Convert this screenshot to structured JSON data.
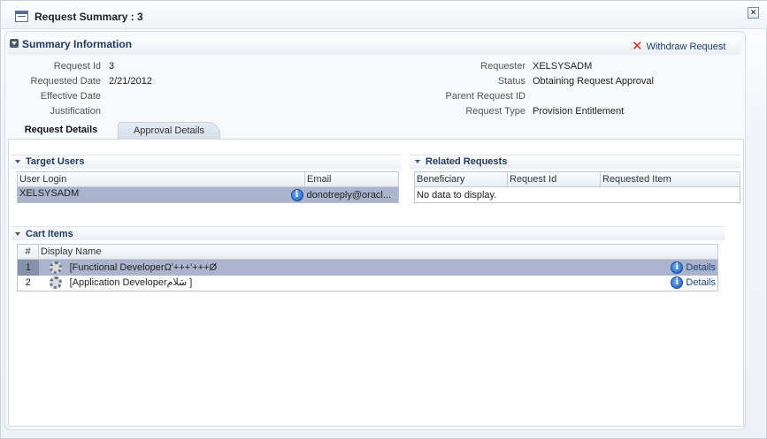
{
  "window": {
    "title": "Request Summary : 3",
    "close_glyph": "×"
  },
  "summary": {
    "title": "Summary Information",
    "withdraw_label": "Withdraw Request",
    "left_fields": [
      {
        "label": "Request Id",
        "value": "3"
      },
      {
        "label": "Requested Date",
        "value": "2/21/2012"
      },
      {
        "label": "Effective Date",
        "value": ""
      },
      {
        "label": "Justification",
        "value": ""
      }
    ],
    "right_fields": [
      {
        "label": "Requester",
        "value": "XELSYSADM"
      },
      {
        "label": "Status",
        "value": "Obtaining Request Approval"
      },
      {
        "label": "Parent Request ID",
        "value": ""
      },
      {
        "label": "Request Type",
        "value": "Provision Entitlement"
      }
    ]
  },
  "tabs": [
    {
      "label": "Request Details",
      "active": true
    },
    {
      "label": "Approval Details",
      "active": false
    }
  ],
  "target_users": {
    "title": "Target Users",
    "columns": [
      "User Login",
      "Email"
    ],
    "rows": [
      {
        "user_login": "XELSYSADM",
        "email": "donotreply@oracl..."
      }
    ]
  },
  "related_requests": {
    "title": "Related Requests",
    "columns": [
      "Beneficiary",
      "Request Id",
      "Requested Item"
    ],
    "empty_text": "No data to display."
  },
  "cart_items": {
    "title": "Cart Items",
    "columns": [
      "#",
      "Display Name"
    ],
    "rows": [
      {
        "num": "1",
        "name": "[Functional DeveloperΩ'+++'+++Ø",
        "details_label": "Details"
      },
      {
        "num": "2",
        "name": "[Application Developerسَلام ]",
        "details_label": "Details"
      }
    ]
  },
  "colors": {
    "accent": "#1f3a60",
    "selected_row": "#aab4cd",
    "withdraw_icon": "#d0281f"
  }
}
